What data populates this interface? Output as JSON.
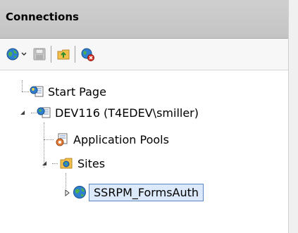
{
  "panel": {
    "title": "Connections"
  },
  "toolbar": {
    "buttons": [
      {
        "icon": "connect-globe-icon",
        "has_dropdown": true
      },
      {
        "icon": "save-icon"
      },
      {
        "icon": "up-folder-icon"
      },
      {
        "icon": "disconnect-icon"
      }
    ]
  },
  "tree": {
    "nodes": [
      {
        "label": "Start Page",
        "icon": "start-page-icon",
        "level": 0,
        "expanded": null
      },
      {
        "label": "DEV116 (T4EDEV\\smiller)",
        "icon": "server-icon",
        "level": 0,
        "expanded": true
      },
      {
        "label": "Application Pools",
        "icon": "app-pools-icon",
        "level": 1,
        "expanded": null
      },
      {
        "label": "Sites",
        "icon": "sites-folder-icon",
        "level": 1,
        "expanded": true
      },
      {
        "label": "SSRPM_FormsAuth",
        "icon": "website-globe-icon",
        "level": 2,
        "expanded": false,
        "selected": true
      }
    ]
  },
  "colors": {
    "title_bg": "#c9c9c9",
    "selection_bg": "#dbe9fa",
    "selection_border": "#5a86c2"
  }
}
